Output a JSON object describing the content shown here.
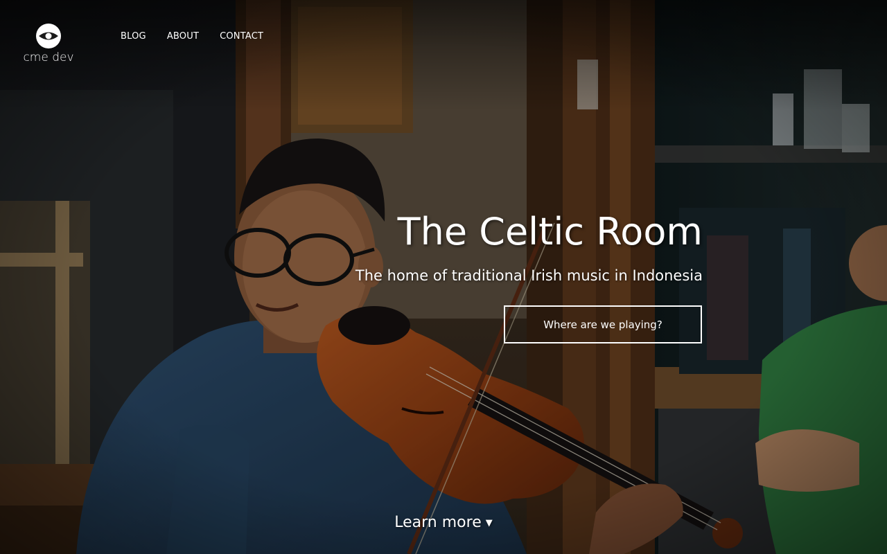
{
  "brand": {
    "name": "cme dev",
    "logo_icon": "eye-icon"
  },
  "nav": {
    "items": [
      {
        "label": "BLOG"
      },
      {
        "label": "ABOUT"
      },
      {
        "label": "CONTACT"
      }
    ]
  },
  "hero": {
    "title": "The Celtic Room",
    "subtitle": "The home of traditional Irish music in Indonesia",
    "cta_label": "Where are we playing?",
    "learn_more_label": "Learn more",
    "learn_more_icon": "triangle-down-icon",
    "background_image": "violinist-photo"
  },
  "colors": {
    "text": "#ffffff",
    "overlay": "#000000"
  }
}
